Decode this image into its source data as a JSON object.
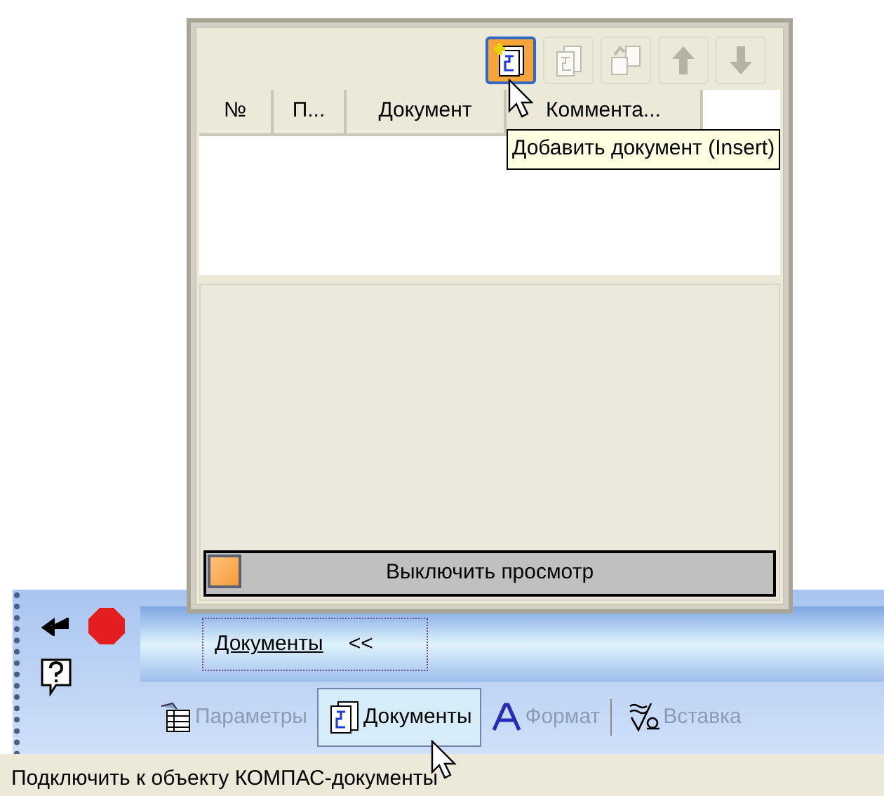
{
  "popup": {
    "tools": [
      {
        "kind": "add",
        "disabled": false,
        "hovered": true
      },
      {
        "kind": "copy",
        "disabled": true,
        "hovered": false
      },
      {
        "kind": "replace",
        "disabled": true,
        "hovered": false
      },
      {
        "kind": "up",
        "disabled": true,
        "hovered": false
      },
      {
        "kind": "down",
        "disabled": true,
        "hovered": false
      }
    ],
    "columns": [
      "№",
      "П...",
      "Документ",
      "Коммента..."
    ],
    "tooltip": "Добавить документ (Insert)",
    "preview_button": "Выключить просмотр"
  },
  "panel": {
    "documents_button": "Документы",
    "collapse": "<<"
  },
  "tabs": [
    {
      "kind": "params",
      "label": "Параметры",
      "selected": false
    },
    {
      "kind": "docs",
      "label": "Документы",
      "selected": true
    },
    {
      "kind": "format",
      "label": "Формат",
      "selected": false
    },
    {
      "kind": "insert",
      "label": "Вставка",
      "selected": false
    }
  ],
  "status_bar": "Подключить к объекту КОМПАС-документы"
}
